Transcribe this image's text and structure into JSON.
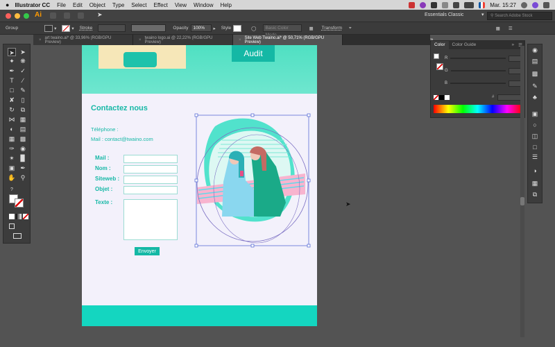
{
  "menubar": {
    "app_name": "Illustrator CC",
    "items": [
      "File",
      "Edit",
      "Object",
      "Type",
      "Select",
      "Effect",
      "View",
      "Window",
      "Help"
    ],
    "clock": "Mar. 15:27"
  },
  "appbar": {
    "workspace": "Essentials Classic",
    "search_placeholder": "Search Adobe Stock"
  },
  "controlbar": {
    "selection_label": "Group",
    "stroke_label": "Stroke",
    "opacity_label": "Opacity",
    "opacity_value": "100%",
    "style_label": "Style",
    "image_trace_label": "Basic Color Mode",
    "transform_label": "Transform"
  },
  "tabs": [
    {
      "label": "art twaino.ai* @ 33,96% (RGB/GPU Preview)"
    },
    {
      "label": "twaino logo.ai @ 22,22% (RGB/GPU Preview)"
    },
    {
      "label": "Site Web Twaino.ai* @ 50,71% (RGB/GPU Preview)"
    }
  ],
  "document": {
    "audit_button": "Audit",
    "heading": "Contactez nous",
    "phone_label": "Téléphone :",
    "mail_line": "Mail : contact@twaino.com",
    "form_labels": [
      "Mail :",
      "Nom :",
      "Siteweb :",
      "Objet :",
      "Texte :"
    ],
    "submit_button": "Envoyer"
  },
  "color_panel": {
    "tabs": [
      "Color",
      "Color Guide"
    ],
    "channels": [
      "R",
      "G",
      "B"
    ],
    "hash_label": "#"
  },
  "colors": {
    "teal": "#14d6c0",
    "teal_text": "#16b8a6",
    "page_bg": "#f3f1fb",
    "canvas_bg": "#535353"
  }
}
